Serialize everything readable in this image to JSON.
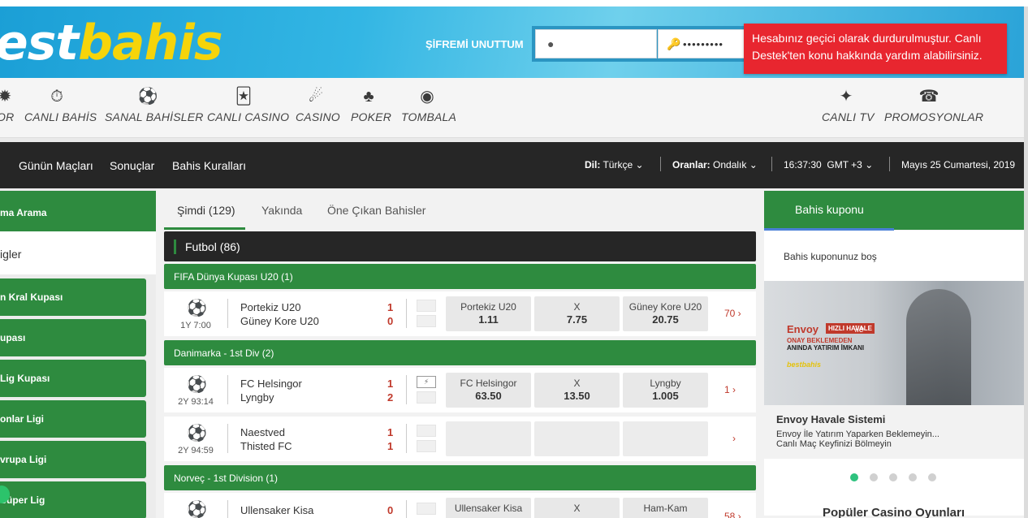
{
  "header": {
    "logo_part1": "est",
    "logo_part2": "bahis",
    "forgot_password": "ŞİFREMİ UNUTTUM",
    "username_value": "",
    "password_value": "•••••••••",
    "alert": "Hesabınız geçici olarak durdurulmuştur. Canlı Destek'ten konu hakkında yardım alabilirsiniz."
  },
  "nav": {
    "items": [
      {
        "label": "OR",
        "icon": "sports-icon"
      },
      {
        "label": "CANLI BAHİS",
        "icon": "stopwatch-icon"
      },
      {
        "label": "SANAL BAHİSLER",
        "icon": "ball-icon"
      },
      {
        "label": "CANLI CASINO",
        "icon": "cards-icon"
      },
      {
        "label": "CASINO",
        "icon": "slot-icon"
      },
      {
        "label": "POKER",
        "icon": "poker-cards-icon"
      },
      {
        "label": "TOMBALA",
        "icon": "bingo-icon"
      },
      {
        "label": "CANLI TV",
        "icon": "runner-icon"
      },
      {
        "label": "PROMOSYONLAR",
        "icon": "gift-icon"
      }
    ]
  },
  "darkbar": {
    "links": [
      "Günün Maçları",
      "Sonuçlar",
      "Bahis Kuralları"
    ],
    "lang_label": "Dil:",
    "lang_value": "Türkçe",
    "odds_label": "Oranlar:",
    "odds_value": "Ondalık",
    "time": "16:37:30",
    "tz": "GMT +3",
    "date": "Mayıs 25 Cumartesi, 2019"
  },
  "left": {
    "search": "ma Arama",
    "favorites": "igler",
    "leagues": [
      "n Kral Kupası",
      "upası",
      "Lig Kupası",
      "onlar Ligi",
      "vrupa Ligi",
      "Süper Lig"
    ]
  },
  "center": {
    "tabs": [
      "Şimdi (129)",
      "Yakında",
      "Öne Çıkan Bahisler"
    ],
    "sport": "Futbol (86)",
    "leagues": [
      {
        "name": "FIFA Dünya Kupası U20 (1)",
        "matches": [
          {
            "time": "1Y 7:00",
            "home": "Portekiz U20",
            "away": "Güney Kore U20",
            "s1": "1",
            "s2": "0",
            "o1n": "Portekiz U20",
            "o1v": "1.11",
            "oxn": "X",
            "oxv": "7.75",
            "o2n": "Güney Kore U20",
            "o2v": "20.75",
            "more": "70 ›"
          }
        ]
      },
      {
        "name": "Danimarka - 1st Div (2)",
        "matches": [
          {
            "time": "2Y 93:14",
            "home": "FC Helsingor",
            "away": "Lyngby",
            "s1": "1",
            "s2": "2",
            "o1n": "FC Helsingor",
            "o1v": "63.50",
            "oxn": "X",
            "oxv": "13.50",
            "o2n": "Lyngby",
            "o2v": "1.005",
            "more": "1 ›"
          },
          {
            "time": "2Y 94:59",
            "home": "Naestved",
            "away": "Thisted FC",
            "s1": "1",
            "s2": "1",
            "more": "›"
          }
        ]
      },
      {
        "name": "Norveç - 1st Division (1)",
        "matches": [
          {
            "home": "Ullensaker Kisa",
            "s1": "0",
            "o1n": "Ullensaker Kisa",
            "oxn": "X",
            "o2n": "Ham-Kam",
            "more": "58 ›"
          }
        ]
      }
    ]
  },
  "right": {
    "coupon_title": "Bahis kuponu",
    "coupon_empty": "Bahis kuponunuz boş",
    "banner_brand": "Envoy",
    "banner_badge": "HIZLI HAVALE",
    "banner_ile": "ile",
    "banner_line1": "ONAY BEKLEMEDEN",
    "banner_line2": "ANINDA YATIRIM İMKANI",
    "banner_logo": "bestbahis",
    "promo_title": "Envoy Havale Sistemi",
    "promo_line1": "Envoy İle Yatırım Yaparken Beklemeyin...",
    "promo_line2": "Canlı Maç Keyfinizi Bölmeyin",
    "casino_title": "Popüler Casino Oyunları"
  }
}
